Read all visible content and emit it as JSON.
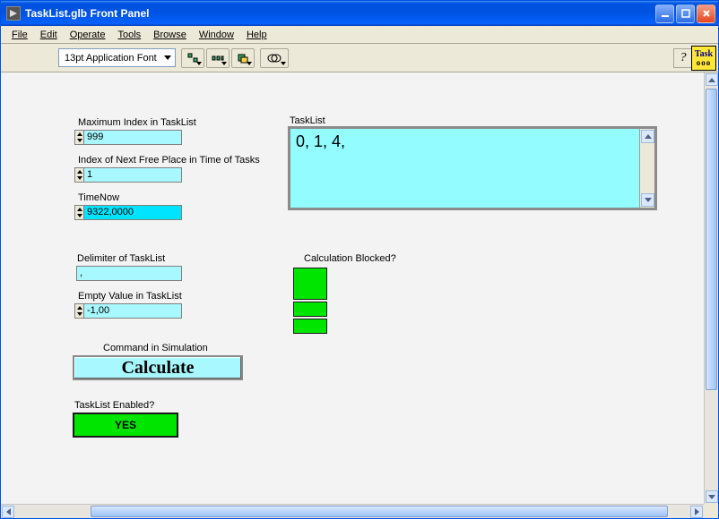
{
  "title": "TaskList.glb Front Panel",
  "menus": [
    "File",
    "Edit",
    "Operate",
    "Tools",
    "Browse",
    "Window",
    "Help"
  ],
  "toolbar": {
    "font_selector": "13pt Application Font",
    "help_symbol": "?",
    "task_tile_label": "Task",
    "task_tile_dots": "ooo"
  },
  "labels": {
    "max_index": "Maximum Index in TaskList",
    "next_free": "Index of Next Free Place in Time of Tasks",
    "time_now": "TimeNow",
    "delimiter": "Delimiter of TaskList",
    "empty_value": "Empty Value in TaskList",
    "command_sim": "Command in Simulation",
    "tasklist_enabled": "TaskList Enabled?",
    "tasklist": "TaskList",
    "calc_blocked": "Calculation Blocked?"
  },
  "values": {
    "max_index": "999",
    "next_free": "1",
    "time_now": "9322,0000",
    "delimiter": ",",
    "empty_value": "-1,00",
    "calculate_btn": "Calculate",
    "yes_btn": "YES",
    "tasklist_text": "0, 1, 4,"
  },
  "colors": {
    "field_cyan": "#a7f8ff",
    "bright_cyan": "#00e4ff",
    "green": "#00e500",
    "titlebar_blue": "#0053e1"
  }
}
